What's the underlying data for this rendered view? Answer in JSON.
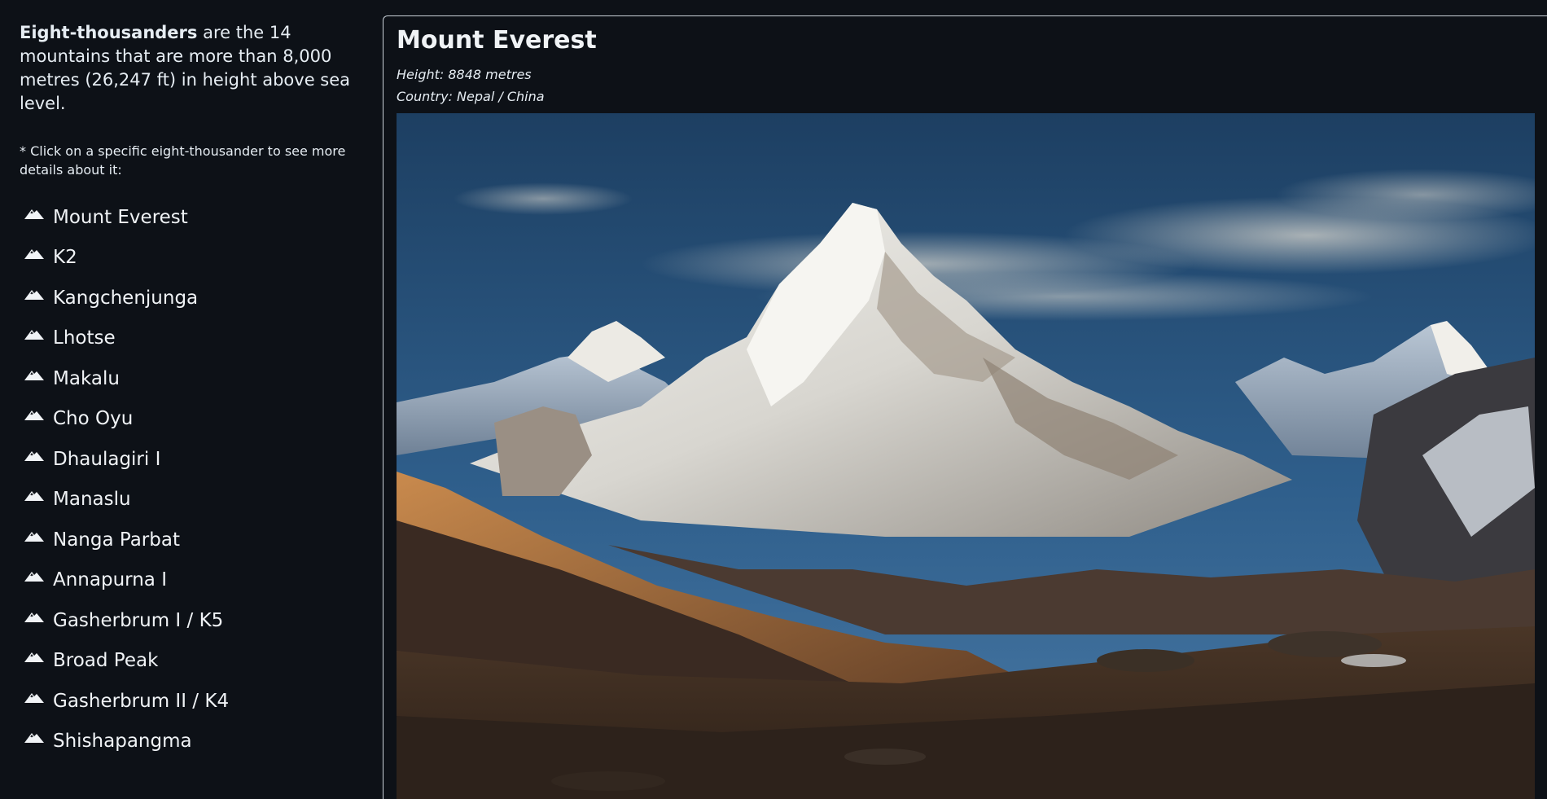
{
  "sidebar": {
    "intro_bold": "Eight-thousanders",
    "intro_rest": " are the 14 mountains that are more than 8,000 metres (26,247 ft) in height above sea level.",
    "note": "* Click on a specific eight-thousander to see more details about it:",
    "icon": "mountain-icon",
    "items": [
      {
        "label": "Mount Everest"
      },
      {
        "label": "K2"
      },
      {
        "label": "Kangchenjunga"
      },
      {
        "label": "Lhotse"
      },
      {
        "label": "Makalu"
      },
      {
        "label": "Cho Oyu"
      },
      {
        "label": "Dhaulagiri I"
      },
      {
        "label": "Manaslu"
      },
      {
        "label": "Nanga Parbat"
      },
      {
        "label": "Annapurna I"
      },
      {
        "label": "Gasherbrum I / K5"
      },
      {
        "label": "Broad Peak"
      },
      {
        "label": "Gasherbrum II / K4"
      },
      {
        "label": "Shishapangma"
      }
    ]
  },
  "detail": {
    "title": "Mount Everest",
    "height": "Height: 8848 metres",
    "country": "Country: Nepal / China"
  },
  "colors": {
    "background": "#0d1117",
    "text": "#e6edf3",
    "border": "#c9d1d9"
  }
}
